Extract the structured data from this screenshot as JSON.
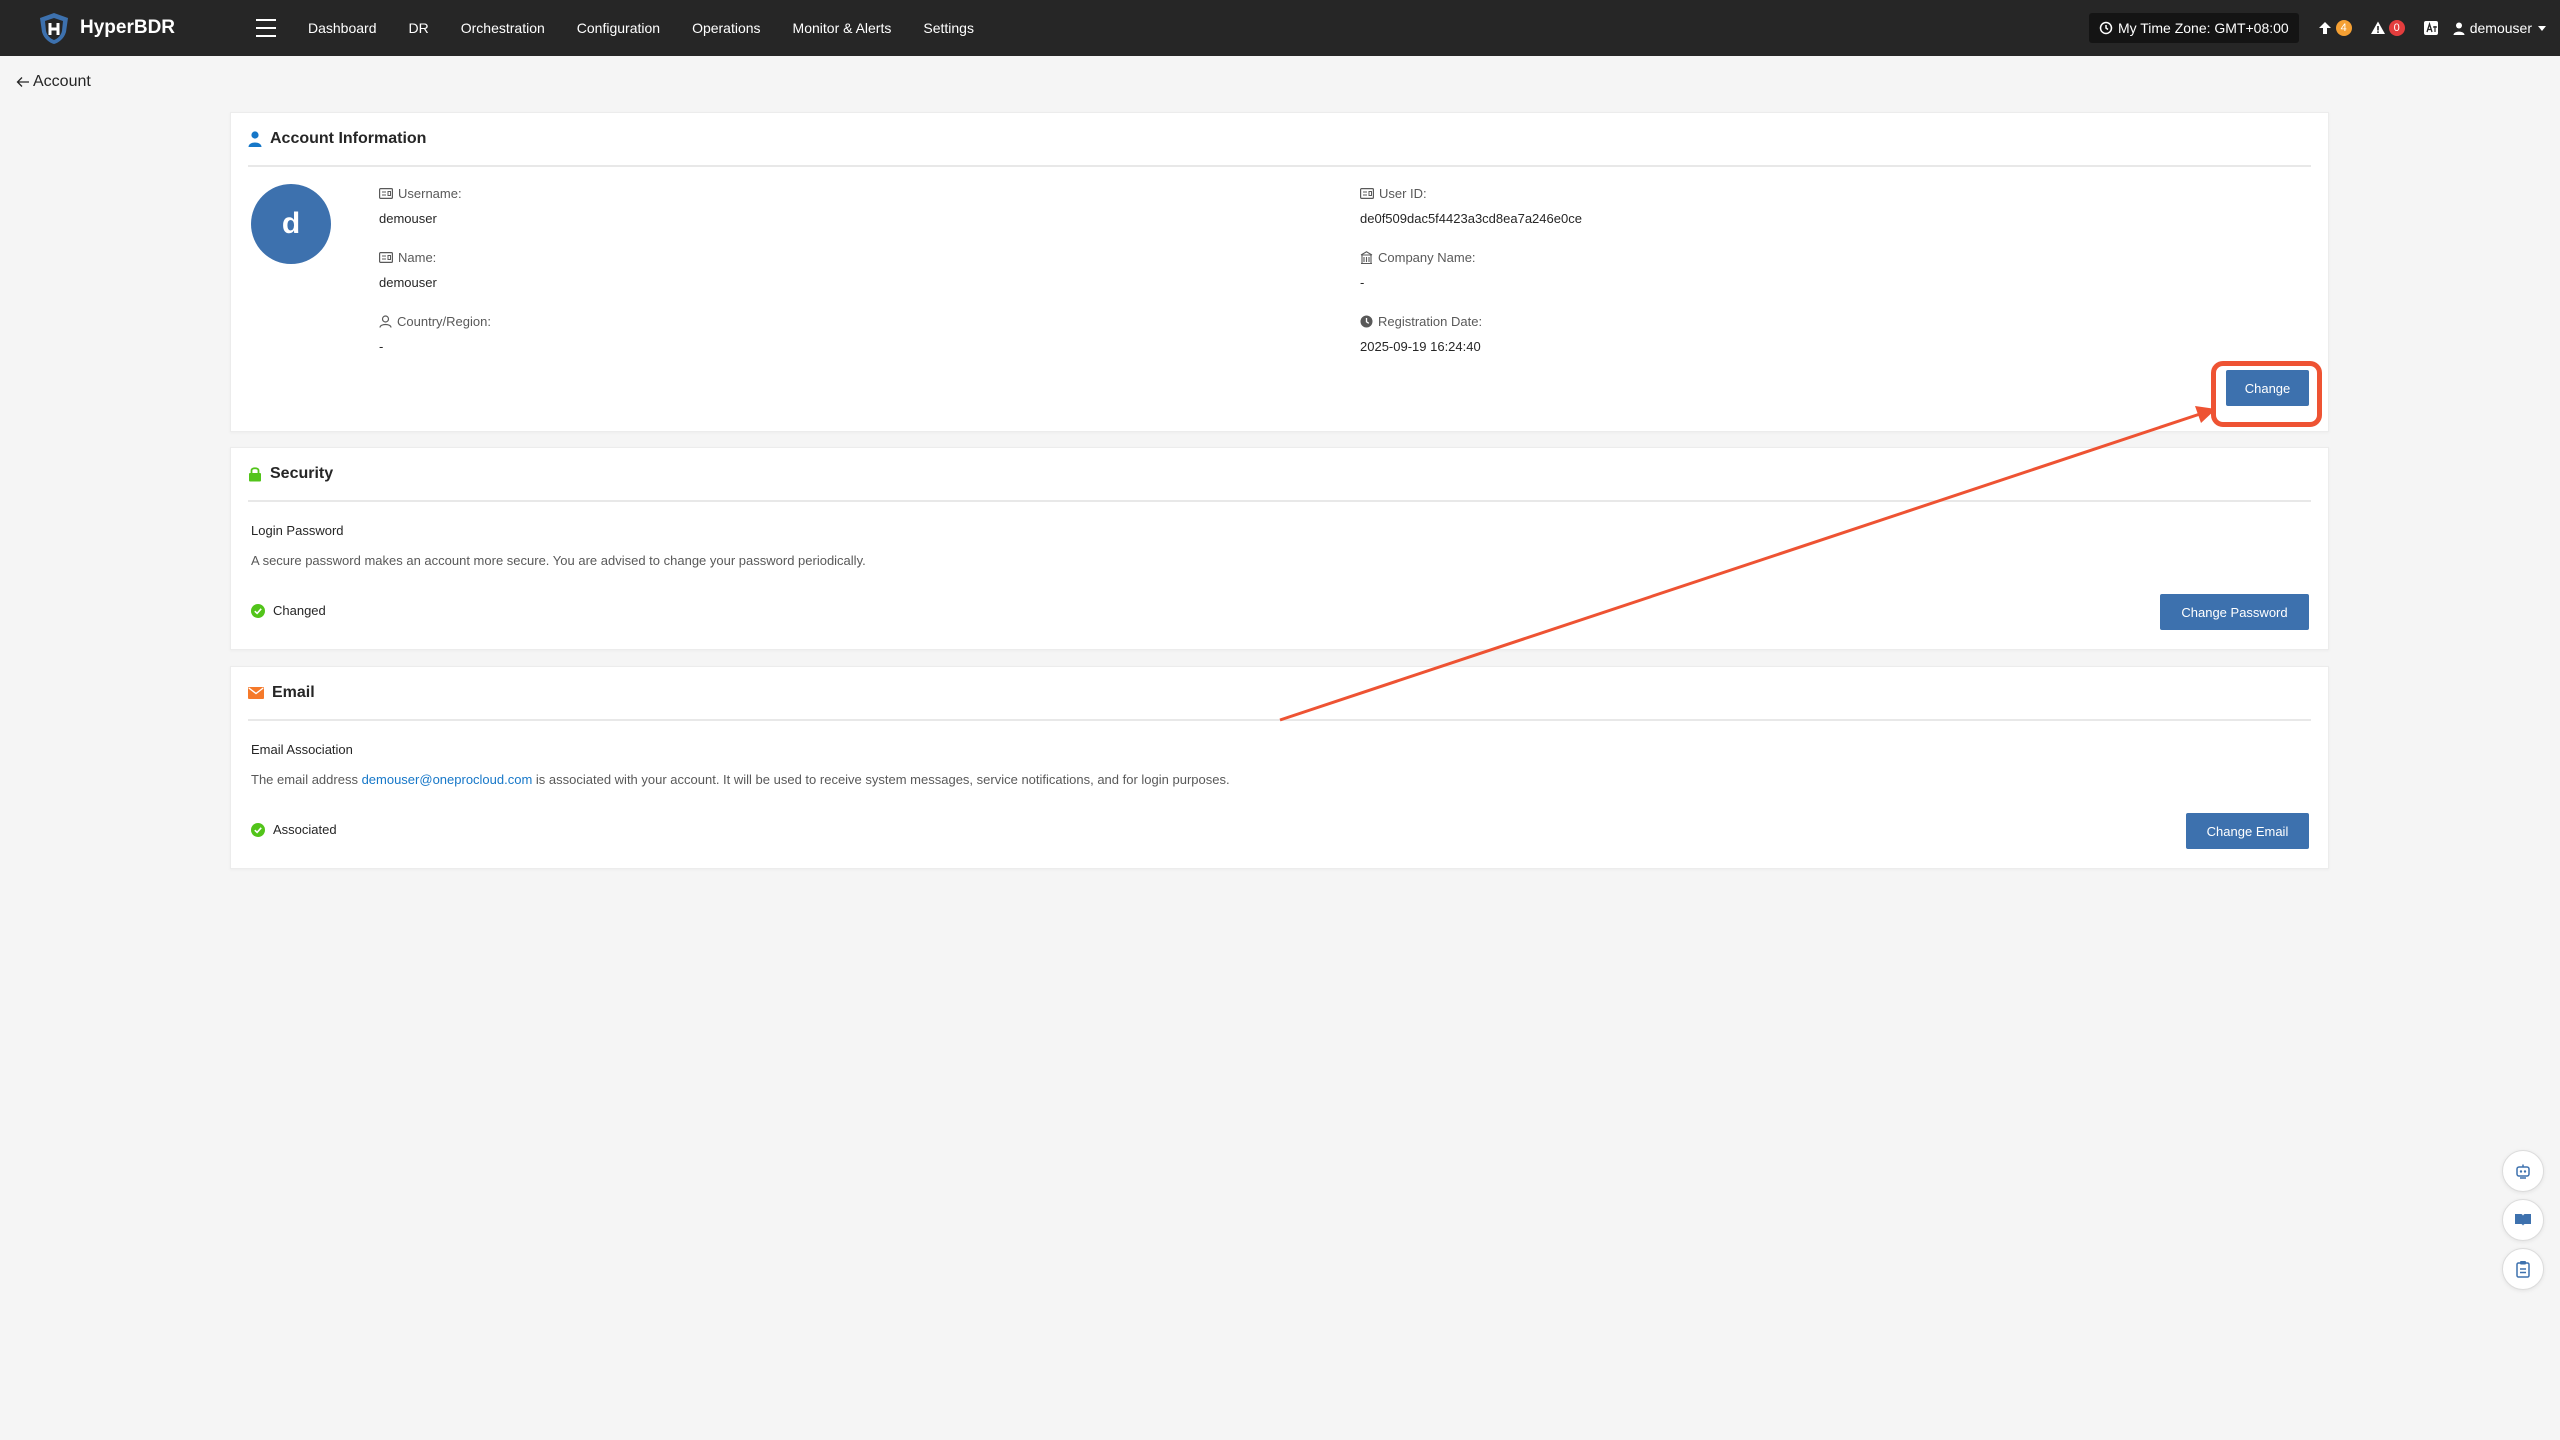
{
  "app": {
    "name": "HyperBDR"
  },
  "nav": {
    "items": [
      {
        "label": "Dashboard"
      },
      {
        "label": "DR"
      },
      {
        "label": "Orchestration"
      },
      {
        "label": "Configuration"
      },
      {
        "label": "Operations"
      },
      {
        "label": "Monitor & Alerts"
      },
      {
        "label": "Settings"
      }
    ]
  },
  "topbar": {
    "timezone": "My Time Zone: GMT+08:00",
    "upgrade_count": "4",
    "alert_count": "0",
    "username": "demouser"
  },
  "breadcrumb": {
    "label": "Account"
  },
  "account": {
    "title": "Account Information",
    "avatar_letter": "d",
    "username_label": "Username:",
    "username": "demouser",
    "name_label": "Name:",
    "name": "demouser",
    "country_label": "Country/Region:",
    "country": "-",
    "user_id_label": "User ID:",
    "user_id": "de0f509dac5f4423a3cd8ea7a246e0ce",
    "company_label": "Company Name:",
    "company": "-",
    "reg_date_label": "Registration Date:",
    "reg_date": "2025-09-19 16:24:40",
    "change_button": "Change"
  },
  "security": {
    "title": "Security",
    "subtitle": "Login Password",
    "description": "A secure password makes an account more secure. You are advised to change your password periodically.",
    "status": "Changed",
    "button": "Change Password"
  },
  "email": {
    "title": "Email",
    "subtitle": "Email Association",
    "desc_prefix": "The email address ",
    "address": "demouser@oneprocloud.com",
    "desc_suffix": " is associated with your account. It will be used to receive system messages, service notifications, and for login purposes.",
    "status": "Associated",
    "button": "Change Email"
  },
  "colors": {
    "topbar": "#262626",
    "primary": "#3d71ae",
    "success": "#52c41a",
    "annotation": "#ee5333",
    "link": "#1677c8"
  }
}
